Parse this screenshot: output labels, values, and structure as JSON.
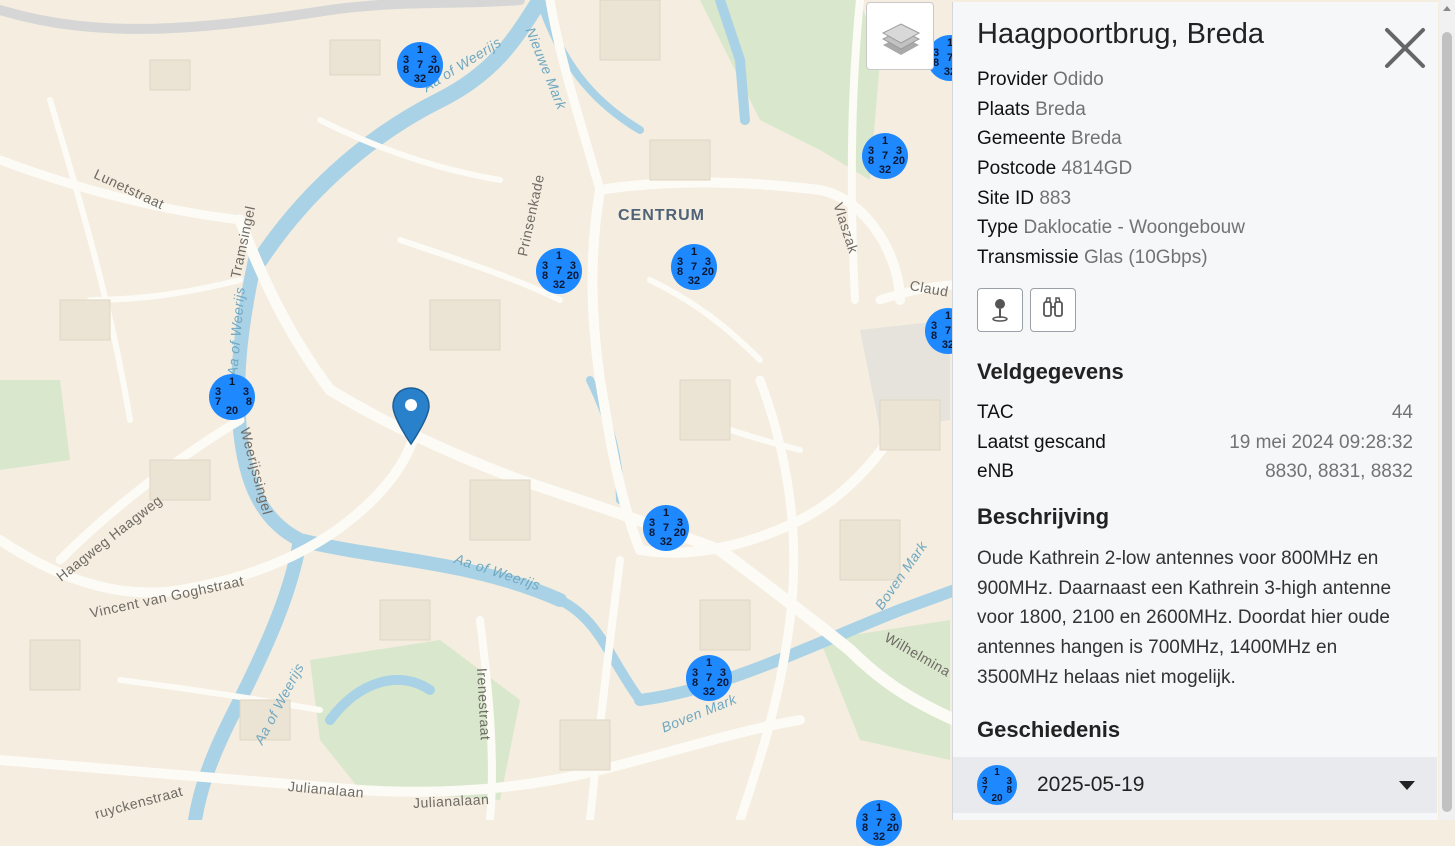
{
  "map": {
    "district_label": "CENTRUM",
    "street_labels": [
      {
        "text": "Lunetstraat"
      },
      {
        "text": "Tramsingel"
      },
      {
        "text": "Prinsenkade"
      },
      {
        "text": "Nieuwe Mark"
      },
      {
        "text": "Vlaszak"
      },
      {
        "text": "Haagweg Haagweg"
      },
      {
        "text": "Vincent van Goghstraat"
      },
      {
        "text": "Irenestraat"
      },
      {
        "text": "Julianalaan"
      },
      {
        "text": "Julianalaan"
      },
      {
        "text": "Wilhelmina"
      },
      {
        "text": "Claud"
      },
      {
        "text": "Weerijssingel"
      },
      {
        "text": "ruyckenstraat"
      }
    ],
    "water_labels": [
      {
        "text": "Aa of Weerijs"
      },
      {
        "text": "Aa of Weerijs"
      },
      {
        "text": "Aa of Weerijs"
      },
      {
        "text": "Aa of Weerijs"
      },
      {
        "text": "Boven Mark"
      },
      {
        "text": "Boven Mark"
      }
    ],
    "markers": [
      {
        "top": "1",
        "l1": "3",
        "l2": "8",
        "mid": "7",
        "r1": "3",
        "r2": "20",
        "bot": "32"
      },
      {
        "top": "1",
        "l1": "3",
        "l2": "8",
        "mid": "7",
        "r1": "3",
        "r2": "20",
        "bot": "32"
      },
      {
        "top": "1",
        "l1": "3",
        "l2": "8",
        "mid": "7",
        "r1": "3",
        "r2": "20",
        "bot": "32"
      },
      {
        "top": "1",
        "l1": "3",
        "l2": "8",
        "mid": "7",
        "r1": "3",
        "r2": "20",
        "bot": "32"
      },
      {
        "top": "1",
        "l1": "3",
        "l2": "7",
        "mid": "",
        "r1": "3",
        "r2": "8",
        "bot": "20"
      },
      {
        "top": "1",
        "l1": "3",
        "l2": "8",
        "mid": "7",
        "r1": "3",
        "r2": "20",
        "bot": "32"
      },
      {
        "top": "1",
        "l1": "3",
        "l2": "8",
        "mid": "7",
        "r1": "3",
        "r2": "20",
        "bot": "32"
      },
      {
        "top": "1",
        "l1": "3",
        "l2": "8",
        "mid": "7",
        "r1": "3",
        "r2": "20",
        "bot": "32"
      },
      {
        "top": "1",
        "l1": "3",
        "l2": "8",
        "mid": "7",
        "r1": "3",
        "r2": "20",
        "bot": "32"
      },
      {
        "top": "1",
        "l1": "3",
        "l2": "8",
        "mid": "7",
        "r1": "3",
        "r2": "20",
        "bot": "32"
      }
    ],
    "colors": {
      "background": "#f4ede0",
      "road": "#fdfbf6",
      "water": "#a9d2e6",
      "park": "#d9e8cc",
      "marker": "#1e88ff",
      "pin": "#2a81cb"
    },
    "layer_button_icon": "layers-icon",
    "pin_icon": "map-pin-icon"
  },
  "panel": {
    "title": "Haagpoortbrug, Breda",
    "close_icon": "close-icon",
    "info": [
      {
        "label": "Provider",
        "value": "Odido"
      },
      {
        "label": "Plaats",
        "value": "Breda"
      },
      {
        "label": "Gemeente",
        "value": "Breda"
      },
      {
        "label": "Postcode",
        "value": "4814GD"
      },
      {
        "label": "Site ID",
        "value": "883"
      },
      {
        "label": "Type",
        "value": "Daklocatie - Woongebouw"
      },
      {
        "label": "Transmissie",
        "value": "Glas (10Gbps)"
      }
    ],
    "actions": [
      {
        "icon": "map-pin-icon"
      },
      {
        "icon": "binoculars-icon"
      }
    ],
    "veldgegevens": {
      "title": "Veldgegevens",
      "rows": [
        {
          "key": "TAC",
          "value": "44"
        },
        {
          "key": "Laatst gescand",
          "value": "19 mei 2024 09:28:32"
        },
        {
          "key": "eNB",
          "value": "8830, 8831, 8832"
        }
      ]
    },
    "beschrijving": {
      "title": "Beschrijving",
      "text": "Oude Kathrein 2-low antennes voor 800MHz en 900MHz. Daarnaast een Kathrein 3-high antenne voor 1800, 2100 en 2600MHz. Doordat hier oude antennes hangen is 700MHz, 1400MHz en 3500MHz helaas niet mogelijk."
    },
    "geschiedenis": {
      "title": "Geschiedenis",
      "entries": [
        {
          "date": "2025-05-19",
          "badge": {
            "top": "1",
            "l1": "3",
            "l2": "7",
            "r1": "3",
            "r2": "8",
            "bot": "20"
          },
          "icon": "chevron-down-icon"
        }
      ]
    }
  }
}
